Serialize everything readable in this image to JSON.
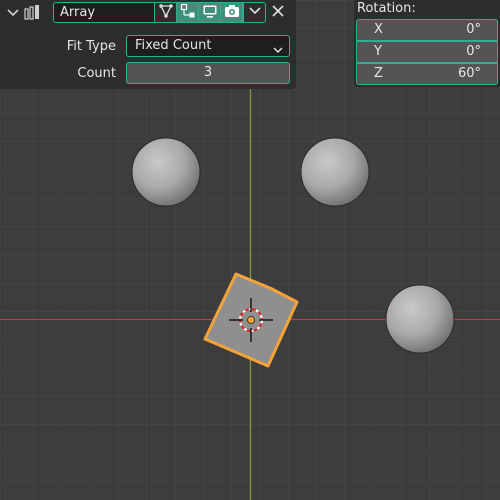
{
  "modifier": {
    "name": "Array",
    "fit_type_label": "Fit Type",
    "fit_type_value": "Fixed Count",
    "count_label": "Count",
    "count_value": "3",
    "toggles": {
      "edit_mode": "edit-mode-icon",
      "on_cage": "cage-icon",
      "viewport": "monitor-icon",
      "render": "camera-icon"
    }
  },
  "rotation": {
    "title": "Rotation:",
    "x_label": "X",
    "x_value": "0°",
    "y_label": "Y",
    "y_value": "0°",
    "z_label": "Z",
    "z_value": "60°"
  },
  "colors": {
    "grid_line": "#4a4a4a",
    "x_axis": "#b3414a",
    "y_axis": "#85a03b",
    "selection": "#f4a23a",
    "accent": "#2eb08e"
  }
}
